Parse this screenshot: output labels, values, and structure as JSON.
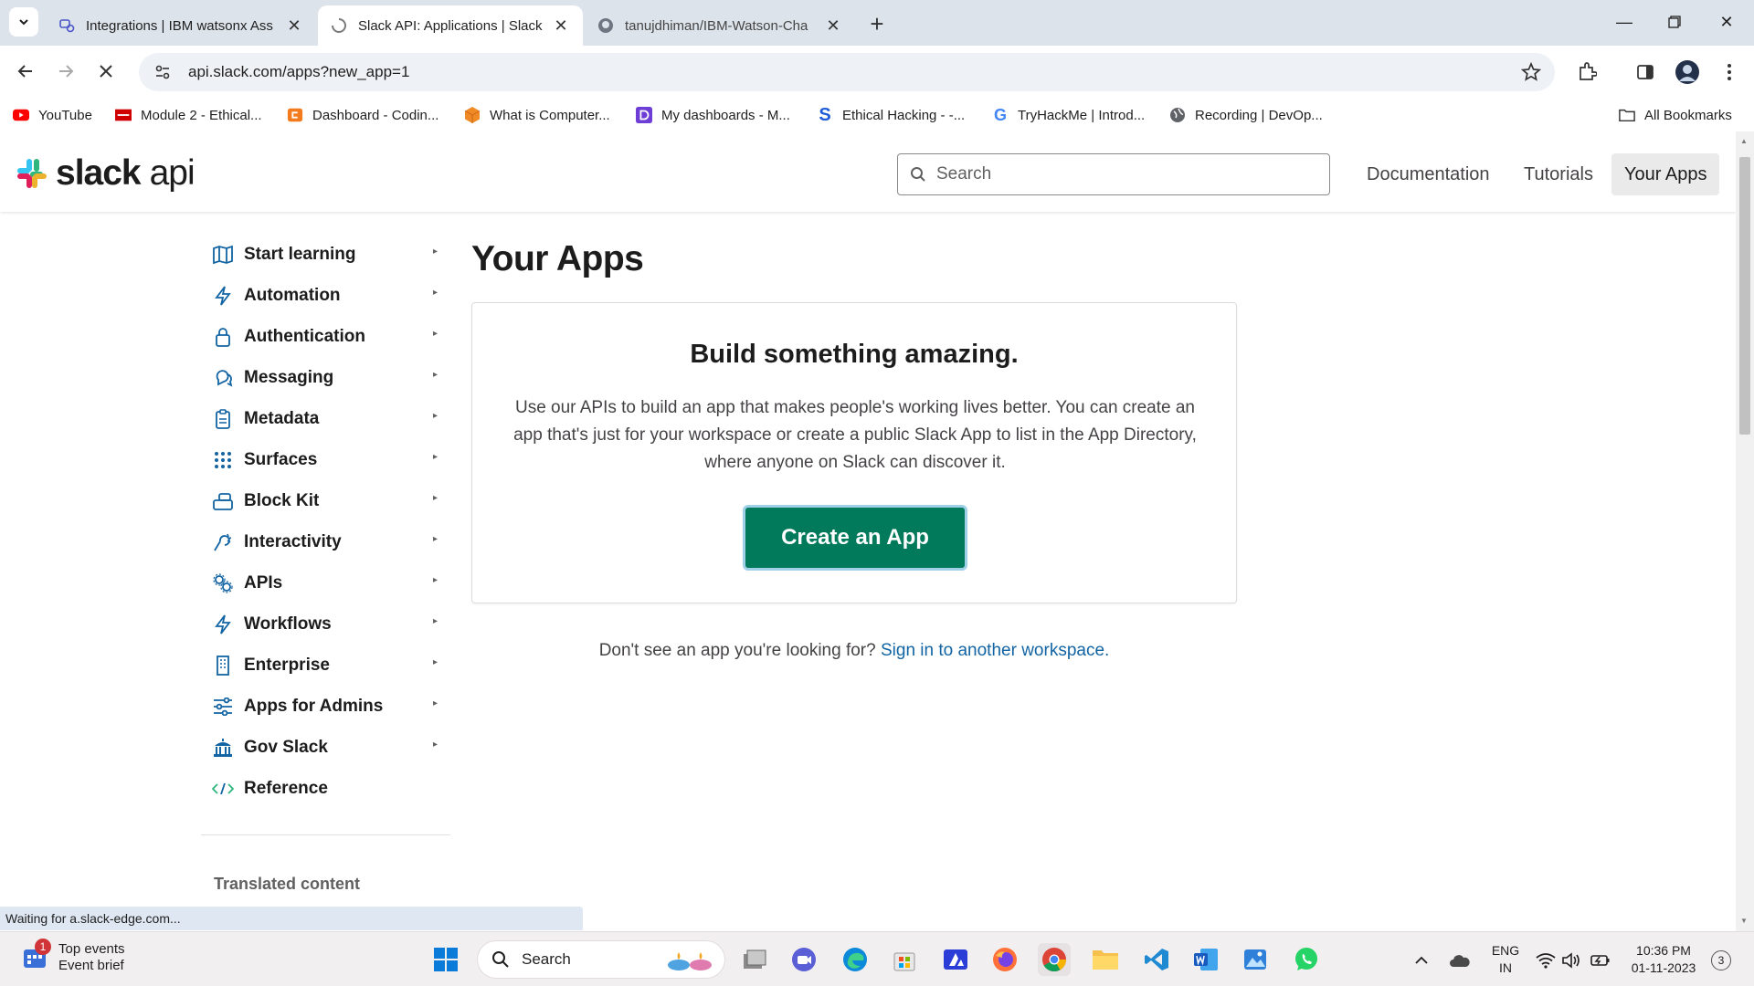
{
  "browser": {
    "tabs": [
      {
        "title": "Integrations | IBM watsonx Ass",
        "favicon": "ibm-watsonx-icon",
        "active": false
      },
      {
        "title": "Slack API: Applications | Slack",
        "favicon": "slack-loading-icon",
        "active": true
      },
      {
        "title": "tanujdhiman/IBM-Watson-Cha",
        "favicon": "github-icon",
        "active": false
      }
    ],
    "url": "api.slack.com/apps?new_app=1",
    "bookmarks": [
      {
        "label": "YouTube",
        "icon": "youtube-icon",
        "color": "#ff0000"
      },
      {
        "label": "Module 2 - Ethical...",
        "icon": "ec-council-icon",
        "color": "#d00000"
      },
      {
        "label": "Dashboard - Codin...",
        "icon": "coding-ninjas-icon",
        "color": "#f37b1d"
      },
      {
        "label": "What is Computer...",
        "icon": "cube-icon",
        "color": "#f08a24"
      },
      {
        "label": "My dashboards - M...",
        "icon": "dashboard-d-icon",
        "color": "#6e3dd6"
      },
      {
        "label": "Ethical Hacking - -...",
        "icon": "s-icon",
        "color": "#1f5bd8"
      },
      {
        "label": "TryHackMe | Introd...",
        "icon": "google-icon",
        "color": "#4285f4"
      },
      {
        "label": "Recording | DevOp...",
        "icon": "globe-icon",
        "color": "#5f6368"
      }
    ],
    "all_bookmarks": "All Bookmarks",
    "status": "Waiting for a.slack-edge.com..."
  },
  "page": {
    "logo_bold": "slack",
    "logo_light": "api",
    "search_placeholder": "Search",
    "nav": [
      {
        "label": "Documentation",
        "active": false
      },
      {
        "label": "Tutorials",
        "active": false
      },
      {
        "label": "Your Apps",
        "active": true
      }
    ],
    "sidebar": [
      {
        "label": "Start learning",
        "icon": "book-icon"
      },
      {
        "label": "Automation",
        "icon": "lightning-icon"
      },
      {
        "label": "Authentication",
        "icon": "lock-icon"
      },
      {
        "label": "Messaging",
        "icon": "chat-bubbles-icon"
      },
      {
        "label": "Metadata",
        "icon": "clipboard-icon"
      },
      {
        "label": "Surfaces",
        "icon": "grid-dots-icon"
      },
      {
        "label": "Block Kit",
        "icon": "blocks-icon"
      },
      {
        "label": "Interactivity",
        "icon": "cursor-spark-icon"
      },
      {
        "label": "APIs",
        "icon": "gears-icon"
      },
      {
        "label": "Workflows",
        "icon": "lightning-icon"
      },
      {
        "label": "Enterprise",
        "icon": "building-icon"
      },
      {
        "label": "Apps for Admins",
        "icon": "sliders-icon"
      },
      {
        "label": "Gov Slack",
        "icon": "government-icon"
      },
      {
        "label": "Reference",
        "icon": "code-icon"
      }
    ],
    "translated": "Translated content",
    "title": "Your Apps",
    "card": {
      "heading": "Build something amazing.",
      "body": "Use our APIs to build an app that makes people's working lives better. You can create an app that's just for your workspace or create a public Slack App to list in the App Directory, where anyone on Slack can discover it.",
      "button": "Create an App"
    },
    "footer_text": "Don't see an app you're looking for?",
    "footer_link": "Sign in to another workspace."
  },
  "taskbar": {
    "widget_title": "Top events",
    "widget_sub": "Event brief",
    "widget_badge": "1",
    "search_label": "Search",
    "apps": [
      "windows-start-icon",
      "file-explorer-alt-icon",
      "zoom-meeting-icon",
      "edge-icon",
      "microsoft-store-icon",
      "azure-icon",
      "firefox-icon",
      "chrome-icon",
      "file-explorer-icon",
      "vscode-icon",
      "word-icon",
      "photos-icon",
      "whatsapp-icon"
    ],
    "lang_top": "ENG",
    "lang_bottom": "IN",
    "time": "10:36 PM",
    "date": "01-11-2023",
    "notifications": "3"
  },
  "colors": {
    "slack_green_button": "#007a5a",
    "link_blue": "#1264a3",
    "tabbar_bg": "#dde3ea"
  }
}
